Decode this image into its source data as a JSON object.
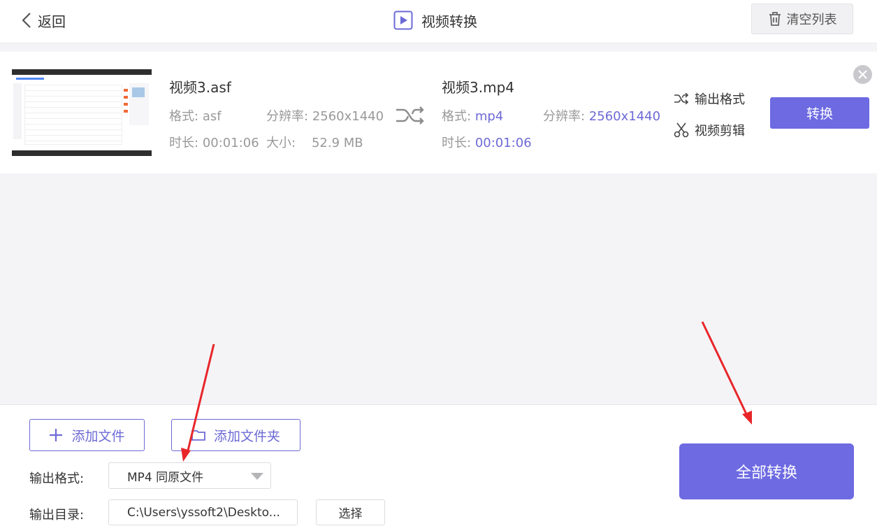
{
  "header": {
    "back_label": "返回",
    "title": "视频转换",
    "clear_label": "清空列表"
  },
  "file": {
    "source": {
      "name": "视频3.asf",
      "format_label": "格式:",
      "format": "asf",
      "resolution_label": "分辨率:",
      "resolution": "2560x1440",
      "duration_label": "时长:",
      "duration": "00:01:06",
      "size_label": "大小:",
      "size": "52.9 MB"
    },
    "target": {
      "name": "视频3.mp4",
      "format_label": "格式:",
      "format": "mp4",
      "resolution_label": "分辨率:",
      "resolution": "2560x1440",
      "duration_label": "时长:",
      "duration": "00:01:06"
    },
    "output_format_label": "输出格式",
    "video_edit_label": "视频剪辑",
    "convert_label": "转换"
  },
  "footer": {
    "add_file_label": "添加文件",
    "add_folder_label": "添加文件夹",
    "output_format_label": "输出格式:",
    "output_format_value": "MP4 同原文件",
    "output_dir_label": "输出目录:",
    "output_dir_value": "C:\\Users\\yssoft2\\Deskto...",
    "choose_label": "选择",
    "convert_all_label": "全部转换"
  },
  "colors": {
    "accent": "#6d6ae2",
    "annotation_arrow": "#e8262a"
  },
  "icons": {
    "back": "chevron-left-icon",
    "title": "play-square-icon",
    "clear": "trash-icon",
    "shuffle": "shuffle-icon",
    "edit": "scissors-icon",
    "close": "close-circle-icon",
    "add_file": "plus-icon",
    "add_folder": "folder-icon"
  }
}
